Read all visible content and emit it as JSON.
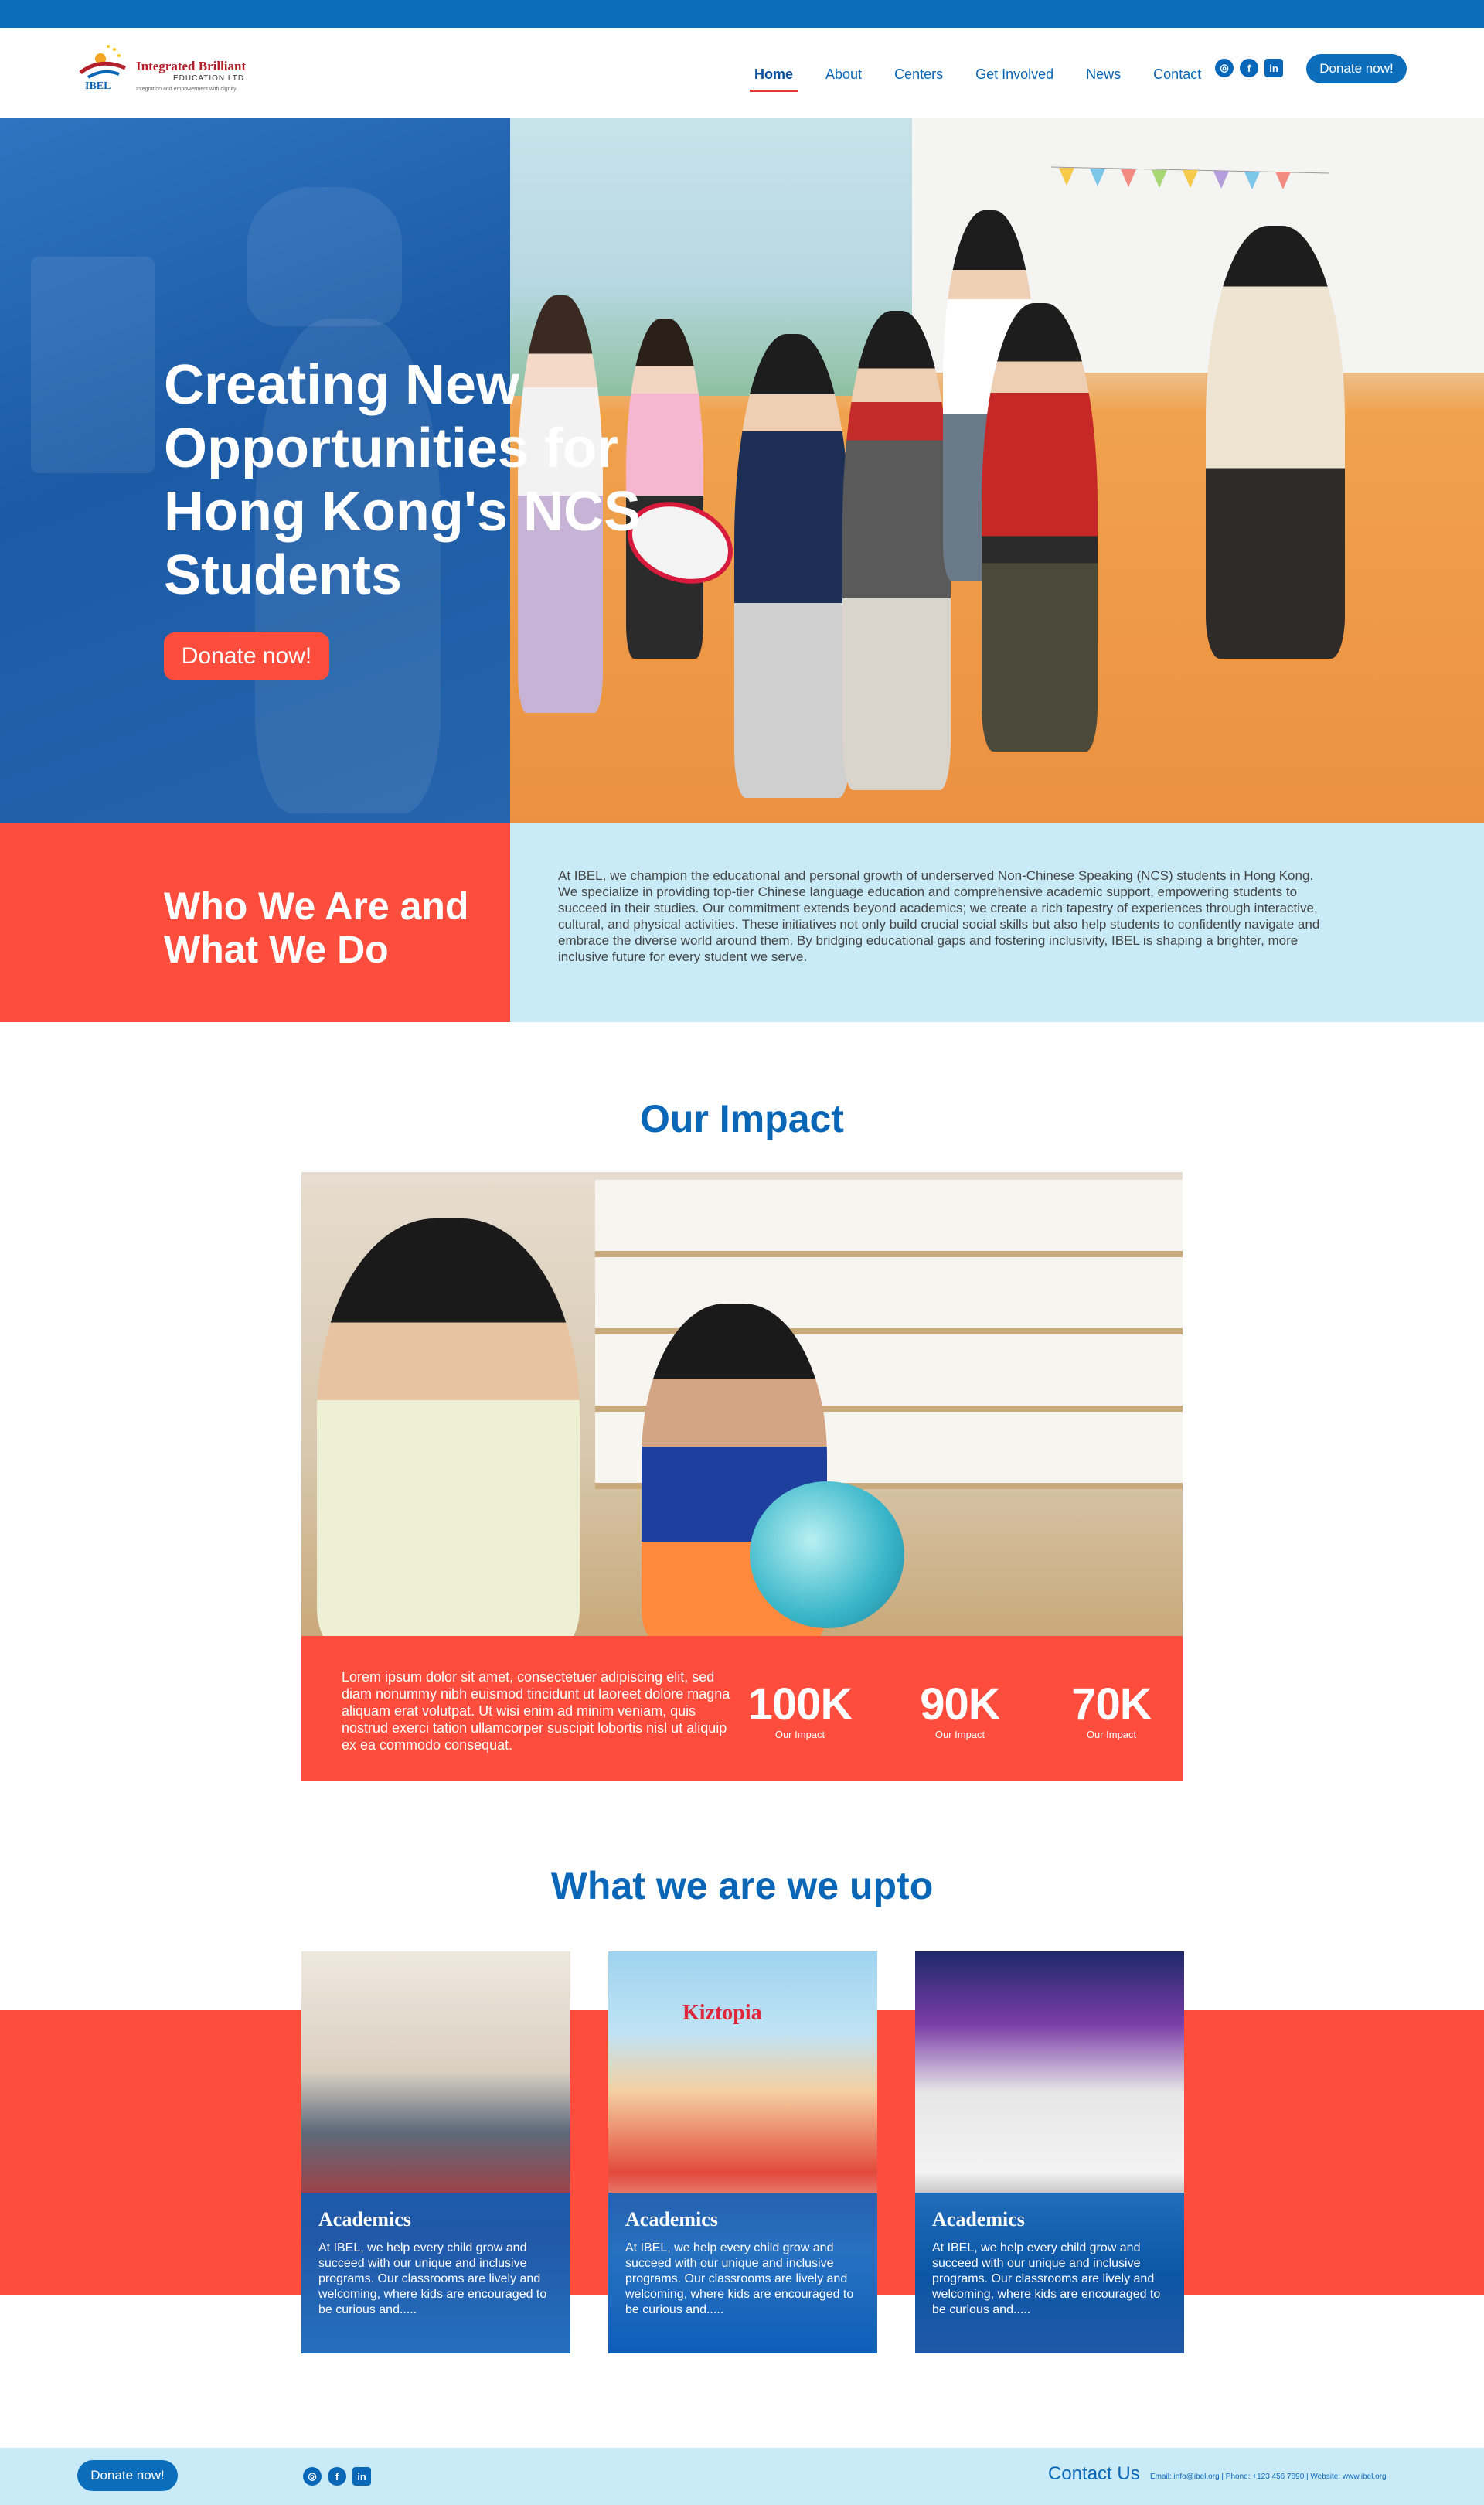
{
  "colors": {
    "blue": "#0a67b8",
    "red": "#ff4d3d",
    "light_blue": "#c9ebf7"
  },
  "logo": {
    "title": "Integrated Brilliant",
    "subtitle": "EDUCATION LTD",
    "abbr": "IBEL",
    "tagline": "Integration and empowerment with dignity"
  },
  "nav": {
    "items": [
      {
        "label": "Home",
        "active": true
      },
      {
        "label": "About"
      },
      {
        "label": "Centers"
      },
      {
        "label": "Get Involved"
      },
      {
        "label": "News"
      },
      {
        "label": "Contact"
      }
    ],
    "social": [
      "instagram-icon",
      "facebook-icon",
      "linkedin-icon"
    ],
    "donate_label": "Donate now!"
  },
  "hero": {
    "title": "Creating New Opportunities for Hong Kong's NCS Students",
    "donate_label": "Donate now!"
  },
  "who": {
    "title": "Who We Are and What We Do",
    "text": "At IBEL, we champion the educational and personal growth of underserved Non-Chinese Speaking (NCS) students in Hong Kong. We specialize in providing top-tier Chinese language education and comprehensive academic support, empowering students to succeed in their studies. Our commitment extends beyond academics; we create a rich tapestry of experiences through interactive, cultural, and physical activities. These initiatives not only build crucial social skills but also help students to confidently navigate and embrace the diverse world around them. By bridging educational gaps and fostering inclusivity, IBEL is shaping a brighter, more inclusive future for every student we serve."
  },
  "impact": {
    "title": "Our Impact",
    "text": "Lorem ipsum dolor sit amet, consectetuer adipiscing elit, sed diam nonummy nibh euismod tincidunt ut laoreet dolore magna aliquam erat volutpat. Ut wisi enim ad minim veniam, quis nostrud exerci tation ullamcorper suscipit lobortis nisl ut aliquip ex ea commodo consequat.",
    "stats": [
      {
        "value": "100K",
        "label": "Our Impact"
      },
      {
        "value": "90K",
        "label": "Our Impact"
      },
      {
        "value": "70K",
        "label": "Our Impact"
      }
    ]
  },
  "upto": {
    "title": "What we are we upto",
    "cards": [
      {
        "heading": "Academics",
        "body": "At IBEL, we help every child grow and succeed with our unique and inclusive programs. Our classrooms are lively and welcoming, where kids are encouraged to be curious and....."
      },
      {
        "heading": "Academics",
        "body": "At IBEL, we help every child grow and succeed with our unique and inclusive programs. Our classrooms are lively and welcoming, where kids are encouraged to be curious and....."
      },
      {
        "heading": "Academics",
        "body": "At IBEL, we help every child grow and succeed with our unique and inclusive programs. Our classrooms are lively and welcoming, where kids are encouraged to be curious and....."
      }
    ],
    "card2_sign": "Kiztopia"
  },
  "footer": {
    "donate_label": "Donate now!",
    "contact_title": "Contact Us",
    "contact_line": "Email: info@ibel.org | Phone: +123 456 7890 | Website: www.ibel.org"
  }
}
